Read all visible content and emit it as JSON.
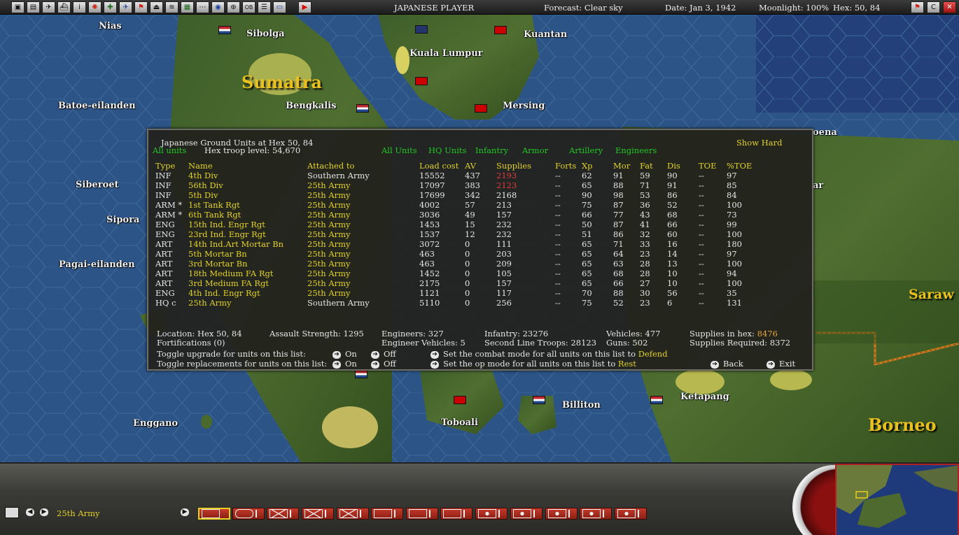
{
  "topbar": {
    "player": "JAPANESE PLAYER",
    "forecast": "Forecast: Clear sky",
    "date": "Date: Jan 3, 1942",
    "moonlight": "Moonlight: 100%",
    "hex": "Hex: 50, 84",
    "icons": [
      "window-icon",
      "report-icon",
      "airgroup-icon",
      "ship-icon",
      "info-icon",
      "rising-sun-icon",
      "air-unit-icon",
      "aircraft-icon",
      "flag-icon",
      "base-icon",
      "sub-icon",
      "map-icon",
      "convoy-icon",
      "globe-icon",
      "air-transfer-icon",
      "ob-icon",
      "list-icon",
      "screen-icon",
      "end-turn-icon"
    ],
    "right_icons": [
      "flag-icon",
      "c-icon",
      "close-icon"
    ]
  },
  "map": {
    "labels": [
      {
        "text": "Nias",
        "big": false
      },
      {
        "text": "Sibolga",
        "big": false
      },
      {
        "text": "Kuantan",
        "big": false
      },
      {
        "text": "Kuala Lumpur",
        "big": false
      },
      {
        "text": "Sumatra",
        "big": true
      },
      {
        "text": "Batoe-eilanden",
        "big": false
      },
      {
        "text": "Bengkalis",
        "big": false
      },
      {
        "text": "Mersing",
        "big": false
      },
      {
        "text": "Siberoet",
        "big": false
      },
      {
        "text": "Sipora",
        "big": false
      },
      {
        "text": "Pagai-eilanden",
        "big": false
      },
      {
        "text": "oena",
        "big": false
      },
      {
        "text": "ar",
        "big": false
      },
      {
        "text": "Saraw",
        "big": true
      },
      {
        "text": "Enggano",
        "big": false
      },
      {
        "text": "Toboali",
        "big": false
      },
      {
        "text": "Billiton",
        "big": false
      },
      {
        "text": "Ketapang",
        "big": false
      },
      {
        "text": "Borneo",
        "big": true
      }
    ]
  },
  "dialog": {
    "title": "Japanese Ground Units at Hex 50, 84",
    "all_units_left": "All units",
    "troop_level": "Hex troop level: 54,670",
    "show_hard": "Show Hard",
    "filters": [
      "All Units",
      "HQ Units",
      "Infantry",
      "Armor",
      "Artillery",
      "Engineers"
    ],
    "headers": [
      "Type",
      "Name",
      "Attached to",
      "Load cost",
      "AV",
      "Supplies",
      "Forts",
      "Xp",
      "Mor",
      "Fat",
      "Dis",
      "TOE",
      "%TOE"
    ],
    "rows": [
      {
        "type": "INF",
        "name": "4th Div",
        "attached": "Southern Army",
        "load": "15552",
        "av": "437",
        "sup": "2193",
        "sup_red": true,
        "forts": "--",
        "xp": "62",
        "mor": "91",
        "fat": "59",
        "dis": "90",
        "toe": "--",
        "ptoe": "97"
      },
      {
        "type": "INF",
        "name": "56th Div",
        "attached": "25th Army",
        "load": "17097",
        "av": "383",
        "sup": "2123",
        "sup_red": true,
        "forts": "--",
        "xp": "65",
        "mor": "88",
        "fat": "71",
        "dis": "91",
        "toe": "--",
        "ptoe": "85"
      },
      {
        "type": "INF",
        "name": "5th Div",
        "attached": "25th Army",
        "load": "17699",
        "av": "342",
        "sup": "2168",
        "sup_red": false,
        "forts": "--",
        "xp": "90",
        "mor": "98",
        "fat": "53",
        "dis": "86",
        "toe": "--",
        "ptoe": "84"
      },
      {
        "type": "ARM *",
        "name": "1st Tank Rgt",
        "attached": "25th Army",
        "load": "4002",
        "av": "57",
        "sup": "213",
        "sup_red": false,
        "forts": "--",
        "xp": "75",
        "mor": "87",
        "fat": "36",
        "dis": "52",
        "toe": "--",
        "ptoe": "100"
      },
      {
        "type": "ARM *",
        "name": "6th Tank Rgt",
        "attached": "25th Army",
        "load": "3036",
        "av": "49",
        "sup": "157",
        "sup_red": false,
        "forts": "--",
        "xp": "66",
        "mor": "77",
        "fat": "43",
        "dis": "68",
        "toe": "--",
        "ptoe": "73"
      },
      {
        "type": "ENG",
        "name": "15th Ind. Engr Rgt",
        "attached": "25th Army",
        "load": "1453",
        "av": "15",
        "sup": "232",
        "sup_red": false,
        "forts": "--",
        "xp": "50",
        "mor": "87",
        "fat": "41",
        "dis": "66",
        "toe": "--",
        "ptoe": "99"
      },
      {
        "type": "ENG",
        "name": "23rd Ind. Engr Rgt",
        "attached": "25th Army",
        "load": "1537",
        "av": "12",
        "sup": "232",
        "sup_red": false,
        "forts": "--",
        "xp": "51",
        "mor": "86",
        "fat": "32",
        "dis": "60",
        "toe": "--",
        "ptoe": "100"
      },
      {
        "type": "ART",
        "name": "14th Ind.Art Mortar Bn",
        "attached": "25th Army",
        "load": "3072",
        "av": "0",
        "sup": "111",
        "sup_red": false,
        "forts": "--",
        "xp": "65",
        "mor": "71",
        "fat": "33",
        "dis": "16",
        "toe": "--",
        "ptoe": "180"
      },
      {
        "type": "ART",
        "name": "5th Mortar Bn",
        "attached": "25th Army",
        "load": "463",
        "av": "0",
        "sup": "203",
        "sup_red": false,
        "forts": "--",
        "xp": "65",
        "mor": "64",
        "fat": "23",
        "dis": "14",
        "toe": "--",
        "ptoe": "97"
      },
      {
        "type": "ART",
        "name": "3rd Mortar Bn",
        "attached": "25th Army",
        "load": "463",
        "av": "0",
        "sup": "209",
        "sup_red": false,
        "forts": "--",
        "xp": "65",
        "mor": "63",
        "fat": "28",
        "dis": "13",
        "toe": "--",
        "ptoe": "100"
      },
      {
        "type": "ART",
        "name": "18th Medium FA Rgt",
        "attached": "25th Army",
        "load": "1452",
        "av": "0",
        "sup": "105",
        "sup_red": false,
        "forts": "--",
        "xp": "65",
        "mor": "68",
        "fat": "28",
        "dis": "10",
        "toe": "--",
        "ptoe": "94"
      },
      {
        "type": "ART",
        "name": "3rd Medium FA Rgt",
        "attached": "25th Army",
        "load": "2175",
        "av": "0",
        "sup": "157",
        "sup_red": false,
        "forts": "--",
        "xp": "65",
        "mor": "66",
        "fat": "27",
        "dis": "10",
        "toe": "--",
        "ptoe": "100"
      },
      {
        "type": "ENG",
        "name": "4th Ind. Engr Rgt",
        "attached": "25th Army",
        "load": "1121",
        "av": "0",
        "sup": "117",
        "sup_red": false,
        "forts": "--",
        "xp": "70",
        "mor": "88",
        "fat": "30",
        "dis": "56",
        "toe": "--",
        "ptoe": "35"
      },
      {
        "type": "HQ c",
        "name": "25th Army",
        "attached": "Southern Army",
        "load": "5110",
        "av": "0",
        "sup": "256",
        "sup_red": false,
        "forts": "--",
        "xp": "75",
        "mor": "52",
        "fat": "23",
        "dis": "6",
        "toe": "--",
        "ptoe": "131"
      }
    ],
    "summary": {
      "location": "Location: Hex 50, 84",
      "fortifications": "Fortifications (0)",
      "assault": "Assault Strength: 1295",
      "engineers": "Engineers: 327",
      "engineer_vehicles": "Engineer Vehicles: 5",
      "infantry": "Infantry: 23276",
      "second_line": "Second Line Troops: 28123",
      "vehicles": "Vehicles: 477",
      "guns": "Guns: 502",
      "supplies_hex_label": "Supplies in hex:",
      "supplies_hex_value": "8476",
      "supplies_required": "Supplies Required: 8372"
    },
    "controls": {
      "toggle_upgrade": "Toggle upgrade for units on this list:",
      "toggle_replacements": "Toggle replacements for units on this list:",
      "on": "On",
      "off": "Off",
      "combat_mode": "Set the combat mode for all units on this list to",
      "combat_value": "Defend",
      "op_mode": "Set the op mode for all units on this list to",
      "op_value": "Rest",
      "back": "Back",
      "exit": "Exit"
    }
  },
  "bottom": {
    "selected_unit": "25th Army"
  }
}
